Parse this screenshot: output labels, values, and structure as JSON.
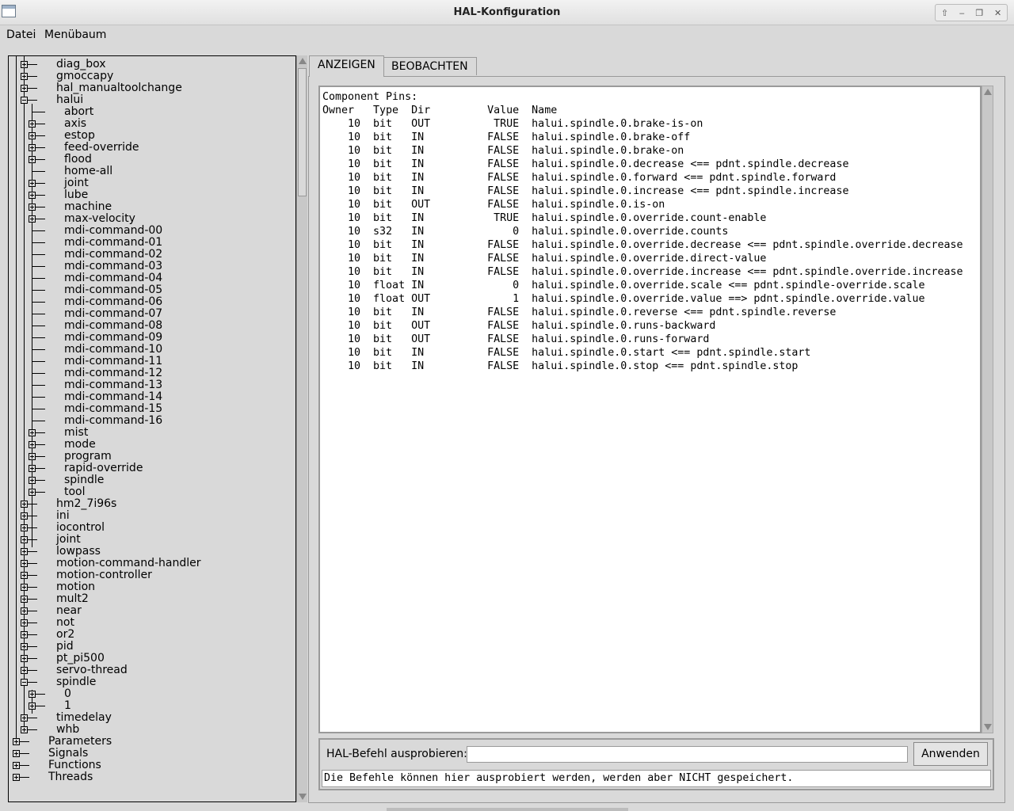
{
  "window": {
    "title": "HAL-Konfiguration"
  },
  "menubar": {
    "items": [
      "Datei",
      "Menübaum"
    ]
  },
  "tree": [
    {
      "level": 1,
      "label": "diag_box",
      "exp": "plus"
    },
    {
      "level": 1,
      "label": "gmoccapy",
      "exp": "plus"
    },
    {
      "level": 1,
      "label": "hal_manualtoolchange",
      "exp": "plus"
    },
    {
      "level": 1,
      "label": "halui",
      "exp": "minus"
    },
    {
      "level": 2,
      "label": "abort",
      "exp": "none"
    },
    {
      "level": 2,
      "label": "axis",
      "exp": "plus"
    },
    {
      "level": 2,
      "label": "estop",
      "exp": "plus"
    },
    {
      "level": 2,
      "label": "feed-override",
      "exp": "plus"
    },
    {
      "level": 2,
      "label": "flood",
      "exp": "plus"
    },
    {
      "level": 2,
      "label": "home-all",
      "exp": "none"
    },
    {
      "level": 2,
      "label": "joint",
      "exp": "plus"
    },
    {
      "level": 2,
      "label": "lube",
      "exp": "plus"
    },
    {
      "level": 2,
      "label": "machine",
      "exp": "plus"
    },
    {
      "level": 2,
      "label": "max-velocity",
      "exp": "plus"
    },
    {
      "level": 2,
      "label": "mdi-command-00",
      "exp": "none"
    },
    {
      "level": 2,
      "label": "mdi-command-01",
      "exp": "none"
    },
    {
      "level": 2,
      "label": "mdi-command-02",
      "exp": "none"
    },
    {
      "level": 2,
      "label": "mdi-command-03",
      "exp": "none"
    },
    {
      "level": 2,
      "label": "mdi-command-04",
      "exp": "none"
    },
    {
      "level": 2,
      "label": "mdi-command-05",
      "exp": "none"
    },
    {
      "level": 2,
      "label": "mdi-command-06",
      "exp": "none"
    },
    {
      "level": 2,
      "label": "mdi-command-07",
      "exp": "none"
    },
    {
      "level": 2,
      "label": "mdi-command-08",
      "exp": "none"
    },
    {
      "level": 2,
      "label": "mdi-command-09",
      "exp": "none"
    },
    {
      "level": 2,
      "label": "mdi-command-10",
      "exp": "none"
    },
    {
      "level": 2,
      "label": "mdi-command-11",
      "exp": "none"
    },
    {
      "level": 2,
      "label": "mdi-command-12",
      "exp": "none"
    },
    {
      "level": 2,
      "label": "mdi-command-13",
      "exp": "none"
    },
    {
      "level": 2,
      "label": "mdi-command-14",
      "exp": "none"
    },
    {
      "level": 2,
      "label": "mdi-command-15",
      "exp": "none"
    },
    {
      "level": 2,
      "label": "mdi-command-16",
      "exp": "none"
    },
    {
      "level": 2,
      "label": "mist",
      "exp": "plus"
    },
    {
      "level": 2,
      "label": "mode",
      "exp": "plus"
    },
    {
      "level": 2,
      "label": "program",
      "exp": "plus"
    },
    {
      "level": 2,
      "label": "rapid-override",
      "exp": "plus"
    },
    {
      "level": 2,
      "label": "spindle",
      "exp": "plus"
    },
    {
      "level": 2,
      "label": "tool",
      "exp": "plus"
    },
    {
      "level": 1,
      "label": "hm2_7i96s",
      "exp": "plus"
    },
    {
      "level": 1,
      "label": "ini",
      "exp": "plus"
    },
    {
      "level": 1,
      "label": "iocontrol",
      "exp": "plus"
    },
    {
      "level": 1,
      "label": "joint",
      "exp": "plus"
    },
    {
      "level": 1,
      "label": "lowpass",
      "exp": "plus"
    },
    {
      "level": 1,
      "label": "motion-command-handler",
      "exp": "plus"
    },
    {
      "level": 1,
      "label": "motion-controller",
      "exp": "plus"
    },
    {
      "level": 1,
      "label": "motion",
      "exp": "plus"
    },
    {
      "level": 1,
      "label": "mult2",
      "exp": "plus"
    },
    {
      "level": 1,
      "label": "near",
      "exp": "plus"
    },
    {
      "level": 1,
      "label": "not",
      "exp": "plus"
    },
    {
      "level": 1,
      "label": "or2",
      "exp": "plus"
    },
    {
      "level": 1,
      "label": "pid",
      "exp": "plus"
    },
    {
      "level": 1,
      "label": "pt_pi500",
      "exp": "plus"
    },
    {
      "level": 1,
      "label": "servo-thread",
      "exp": "plus"
    },
    {
      "level": 1,
      "label": "spindle",
      "exp": "minus"
    },
    {
      "level": 2,
      "label": "0",
      "exp": "plus"
    },
    {
      "level": 2,
      "label": "1",
      "exp": "plus"
    },
    {
      "level": 1,
      "label": "timedelay",
      "exp": "plus"
    },
    {
      "level": 1,
      "label": "whb",
      "exp": "plus"
    },
    {
      "level": 0,
      "label": "Parameters",
      "exp": "plus"
    },
    {
      "level": 0,
      "label": "Signals",
      "exp": "plus"
    },
    {
      "level": 0,
      "label": "Functions",
      "exp": "plus"
    },
    {
      "level": 0,
      "label": "Threads",
      "exp": "plus"
    }
  ],
  "tabs": [
    "ANZEIGEN",
    "BEOBACHTEN"
  ],
  "pins": {
    "heading": "Component Pins:",
    "columns": [
      "Owner",
      "Type",
      "Dir",
      "Value",
      "Name"
    ],
    "rows": [
      [
        "10",
        "bit",
        "OUT",
        "TRUE",
        "halui.spindle.0.brake-is-on"
      ],
      [
        "10",
        "bit",
        "IN",
        "FALSE",
        "halui.spindle.0.brake-off"
      ],
      [
        "10",
        "bit",
        "IN",
        "FALSE",
        "halui.spindle.0.brake-on"
      ],
      [
        "10",
        "bit",
        "IN",
        "FALSE",
        "halui.spindle.0.decrease <== pdnt.spindle.decrease"
      ],
      [
        "10",
        "bit",
        "IN",
        "FALSE",
        "halui.spindle.0.forward <== pdnt.spindle.forward"
      ],
      [
        "10",
        "bit",
        "IN",
        "FALSE",
        "halui.spindle.0.increase <== pdnt.spindle.increase"
      ],
      [
        "10",
        "bit",
        "OUT",
        "FALSE",
        "halui.spindle.0.is-on"
      ],
      [
        "10",
        "bit",
        "IN",
        "TRUE",
        "halui.spindle.0.override.count-enable"
      ],
      [
        "10",
        "s32",
        "IN",
        "0",
        "halui.spindle.0.override.counts"
      ],
      [
        "10",
        "bit",
        "IN",
        "FALSE",
        "halui.spindle.0.override.decrease <== pdnt.spindle.override.decrease"
      ],
      [
        "10",
        "bit",
        "IN",
        "FALSE",
        "halui.spindle.0.override.direct-value"
      ],
      [
        "10",
        "bit",
        "IN",
        "FALSE",
        "halui.spindle.0.override.increase <== pdnt.spindle.override.increase"
      ],
      [
        "10",
        "float",
        "IN",
        "0",
        "halui.spindle.0.override.scale <== pdnt.spindle-override.scale"
      ],
      [
        "10",
        "float",
        "OUT",
        "1",
        "halui.spindle.0.override.value ==> pdnt.spindle.override.value"
      ],
      [
        "10",
        "bit",
        "IN",
        "FALSE",
        "halui.spindle.0.reverse <== pdnt.spindle.reverse"
      ],
      [
        "10",
        "bit",
        "OUT",
        "FALSE",
        "halui.spindle.0.runs-backward"
      ],
      [
        "10",
        "bit",
        "OUT",
        "FALSE",
        "halui.spindle.0.runs-forward"
      ],
      [
        "10",
        "bit",
        "IN",
        "FALSE",
        "halui.spindle.0.start <== pdnt.spindle.start"
      ],
      [
        "10",
        "bit",
        "IN",
        "FALSE",
        "halui.spindle.0.stop <== pdnt.spindle.stop"
      ]
    ]
  },
  "command": {
    "label": "HAL-Befehl ausprobieren:",
    "value": "",
    "button": "Anwenden",
    "hint": "Die Befehle können hier ausprobiert werden, werden aber NICHT gespeichert."
  }
}
